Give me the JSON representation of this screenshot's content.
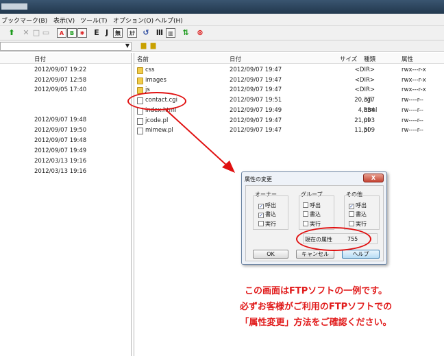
{
  "menu": [
    "ブックマーク(B)",
    "表示(V)",
    "ツール(T)",
    "オプション(O)",
    "ヘルプ(H)"
  ],
  "toolbar_icons": [
    "up-arrow-icon",
    "delete-icon",
    "new-folder-icon",
    "local-icon",
    "ascii-icon",
    "binary-icon",
    "auto-icon",
    "euc-icon",
    "jis-icon",
    "kanji-none-icon",
    "half-kana-icon",
    "refresh-icon",
    "list-icon",
    "details-icon",
    "sync-icon",
    "cancel-icon"
  ],
  "toolbar_glyphs": {
    "euc": "E",
    "jis": "J",
    "none": "無",
    "half": "ｶﾅ"
  },
  "local": {
    "columns": {
      "date": "日付"
    },
    "dates": [
      "2012/09/07 19:22",
      "2012/09/07 12:58",
      "2012/09/05 17:40",
      "2012/09/07 19:48",
      "2012/09/07 19:50",
      "2012/09/07 19:48",
      "2012/09/07 19:49",
      "2012/03/13 19:16",
      "2012/03/13 19:16"
    ]
  },
  "remote": {
    "columns": {
      "name": "名前",
      "date": "日付",
      "size": "サイズ",
      "kind": "種類",
      "attr": "属性"
    },
    "rows": [
      {
        "icon": "folder",
        "name": "css",
        "date": "2012/09/07 19:47",
        "size": "<DIR>",
        "kind": "",
        "attr": "rwx---r-x"
      },
      {
        "icon": "folder",
        "name": "images",
        "date": "2012/09/07 19:47",
        "size": "<DIR>",
        "kind": "",
        "attr": "rwx---r-x"
      },
      {
        "icon": "folder",
        "name": "js",
        "date": "2012/09/07 19:47",
        "size": "<DIR>",
        "kind": "",
        "attr": "rwx---r-x"
      },
      {
        "icon": "file",
        "name": "contact.cgi",
        "date": "2012/09/07 19:51",
        "size": "20,377",
        "kind": "cgi",
        "attr": "rw----r--"
      },
      {
        "icon": "file",
        "name": "index.html",
        "date": "2012/09/07 19:49",
        "size": "4,834",
        "kind": "html",
        "attr": "rw----r--"
      },
      {
        "icon": "file",
        "name": "jcode.pl",
        "date": "2012/09/07 19:47",
        "size": "21,093",
        "kind": "pl",
        "attr": "rw----r--"
      },
      {
        "icon": "file",
        "name": "mimew.pl",
        "date": "2012/09/07 19:47",
        "size": "11,509",
        "kind": "pl",
        "attr": "rw----r--"
      }
    ]
  },
  "dialog": {
    "title": "属性の変更",
    "close": "X",
    "groups": [
      {
        "label": "オーナー",
        "items": [
          {
            "label": "呼出",
            "checked": true
          },
          {
            "label": "書込",
            "checked": true
          },
          {
            "label": "実行",
            "checked": false
          }
        ]
      },
      {
        "label": "グループ",
        "items": [
          {
            "label": "呼出",
            "checked": false
          },
          {
            "label": "書込",
            "checked": false
          },
          {
            "label": "実行",
            "checked": false
          }
        ]
      },
      {
        "label": "その他",
        "items": [
          {
            "label": "呼出",
            "checked": true
          },
          {
            "label": "書込",
            "checked": false
          },
          {
            "label": "実行",
            "checked": false
          }
        ]
      }
    ],
    "current_label": "現在の属性",
    "current_value": "755",
    "ok": "OK",
    "cancel": "キャンセル",
    "help": "ヘルプ"
  },
  "note": [
    "この画面はFTPソフトの一例です。",
    "必ずお客様がご利用のFTPソフトでの",
    "「属性変更」方法をご確認ください。"
  ],
  "colors": {
    "highlight": "#e01010",
    "note": "#e11b1b"
  }
}
